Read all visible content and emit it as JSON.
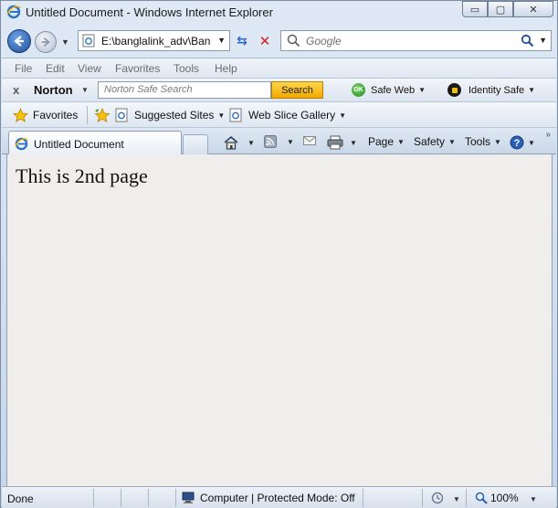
{
  "window": {
    "title": "Untitled Document - Windows Internet Explorer",
    "controls": {
      "minimize": "▭",
      "maximize": "▢",
      "close": "✕"
    }
  },
  "address": {
    "url": "E:\\banglalink_adv\\Ban",
    "search_placeholder": "Google"
  },
  "menu": {
    "items": [
      "File",
      "Edit",
      "View",
      "Favorites",
      "Tools",
      "Help"
    ]
  },
  "norton": {
    "close": "x",
    "brand": "Norton",
    "search_placeholder": "Norton Safe Search",
    "search_button": "Search",
    "ok_badge": "OK",
    "safe_web": "Safe Web",
    "identity_safe": "Identity Safe"
  },
  "favorites_bar": {
    "favorites": "Favorites",
    "suggested_sites": "Suggested Sites",
    "web_slice_gallery": "Web Slice Gallery"
  },
  "tabs": {
    "active_tab": "Untitled Document"
  },
  "command_bar": {
    "page": "Page",
    "safety": "Safety",
    "tools": "Tools"
  },
  "content": {
    "text": "This is 2nd page"
  },
  "status": {
    "state": "Done",
    "zone": "Computer | Protected Mode: Off",
    "zoom": "100%"
  },
  "colors": {
    "norton_search_button": "#f0a800",
    "back_button": "#1f4f9c",
    "stop_button": "#d21f1f",
    "content_bg": "#f0eeec"
  },
  "icons": [
    "ie-logo-icon",
    "back-arrow-icon",
    "forward-arrow-icon",
    "page-icon",
    "refresh-icon",
    "stop-icon",
    "search-icon",
    "ok-icon",
    "lock-icon",
    "favorites-star-icon",
    "add-favorite-icon",
    "home-icon",
    "rss-icon",
    "mail-icon",
    "print-icon",
    "help-icon",
    "computer-icon",
    "zoom-icon"
  ]
}
